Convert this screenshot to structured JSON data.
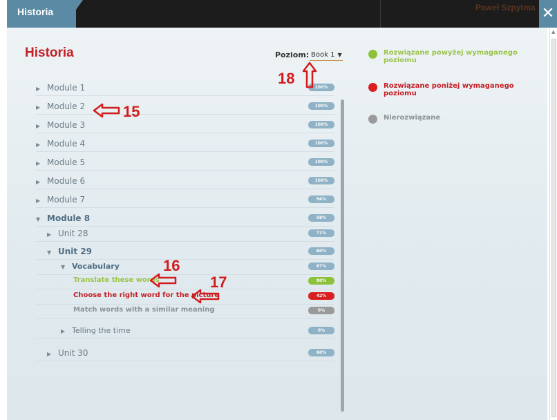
{
  "window": {
    "tab_label": "Historia",
    "user_name": "Paweł Szpytma",
    "close_glyph": "✕"
  },
  "page": {
    "title": "Historia",
    "level_label": "Poziom:",
    "level_value": "Book 1",
    "level_caret": "▼"
  },
  "legend": [
    {
      "text": "Rozwiązane powyżej wymaganego poziomu",
      "color": "#8dc13a"
    },
    {
      "text": "Rozwiązane poniżej wymaganego poziomu",
      "color": "#d92020"
    },
    {
      "text": "Nierozwiązane",
      "color": "#9a9a9a"
    }
  ],
  "tree": [
    {
      "label": "Module 1",
      "badge": "100%",
      "tri": "▶"
    },
    {
      "label": "Module 2",
      "badge": "100%",
      "tri": "▶"
    },
    {
      "label": "Module 3",
      "badge": "100%",
      "tri": "▶"
    },
    {
      "label": "Module 4",
      "badge": "100%",
      "tri": "▶"
    },
    {
      "label": "Module 5",
      "badge": "100%",
      "tri": "▶"
    },
    {
      "label": "Module 6",
      "badge": "100%",
      "tri": "▶"
    },
    {
      "label": "Module 7",
      "badge": "94%",
      "tri": "▶"
    },
    {
      "label": "Module 8",
      "badge": "59%",
      "tri": "▼"
    },
    {
      "label": "Unit 28",
      "badge": "71%",
      "tri": "▶"
    },
    {
      "label": "Unit 29",
      "badge": "60%",
      "tri": "▼"
    },
    {
      "label": "Vocabulary",
      "badge": "67%",
      "tri": "▼"
    },
    {
      "label": "Translate these words",
      "badge": "80%"
    },
    {
      "label": "Choose the right word for the picture",
      "badge": "42%"
    },
    {
      "label": "Match words with a similar meaning",
      "badge": "0%"
    },
    {
      "label": "Telling the time",
      "badge": "0%",
      "tri": "▶"
    },
    {
      "label": "Unit 30",
      "badge": "60%",
      "tri": "▶"
    }
  ],
  "annotations": {
    "n15": "15",
    "n16": "16",
    "n17": "17",
    "n18": "18"
  },
  "colors": {
    "accent_red": "#c41e24",
    "tab_blue": "#5b8aa5",
    "badge_blue": "#8fb2c6"
  }
}
